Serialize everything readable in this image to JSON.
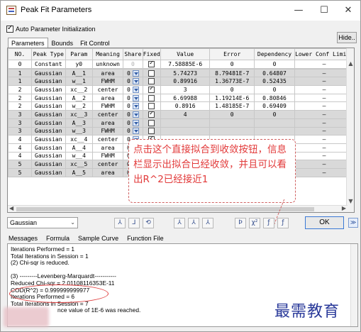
{
  "window": {
    "title": "Peak Fit Parameters",
    "controls": {
      "minimize": "—",
      "maximize": "☐",
      "close": "✕"
    }
  },
  "auto_init": {
    "label": "Auto Parameter Initialization",
    "checked": true
  },
  "hide_button": "Hide..",
  "tabs": [
    "Parameters",
    "Bounds",
    "Fit Control"
  ],
  "columns": [
    "NO.",
    "Peak Type",
    "Param",
    "Meaning",
    "Share",
    "Fixed",
    "Value",
    "Error",
    "Dependency",
    "Lower Conf Limits"
  ],
  "rows": [
    {
      "no": "0",
      "type": "Constant",
      "param": "y0",
      "meaning": "unknown",
      "share": "0",
      "share_dd": false,
      "fixed": true,
      "value": "7.58885E-6",
      "error": "0",
      "dep": "0",
      "lcl": "—",
      "style": "white"
    },
    {
      "no": "1",
      "type": "Gaussian",
      "param": "xc__1",
      "meaning": "center",
      "share": "0",
      "share_dd": true,
      "fixed": true,
      "value": "2",
      "error": "0",
      "dep": "0",
      "lcl": "—",
      "style": "sel"
    },
    {
      "no": "1",
      "type": "Gaussian",
      "param": "A__1",
      "meaning": "area",
      "share": "0",
      "share_dd": true,
      "fixed": false,
      "value": "5.74273",
      "error": "8.79481E-7",
      "dep": "0.64807",
      "lcl": "—",
      "style": "alt"
    },
    {
      "no": "1",
      "type": "Gaussian",
      "param": "w__1",
      "meaning": "FWHM",
      "share": "0",
      "share_dd": true,
      "fixed": false,
      "value": "0.89916",
      "error": "1.36773E-7",
      "dep": "0.52435",
      "lcl": "—",
      "style": "alt"
    },
    {
      "no": "2",
      "type": "Gaussian",
      "param": "xc__2",
      "meaning": "center",
      "share": "0",
      "share_dd": true,
      "fixed": true,
      "value": "3",
      "error": "0",
      "dep": "0",
      "lcl": "—",
      "style": "white"
    },
    {
      "no": "2",
      "type": "Gaussian",
      "param": "A__2",
      "meaning": "area",
      "share": "0",
      "share_dd": true,
      "fixed": false,
      "value": "6.69988",
      "error": "1.19214E-6",
      "dep": "0.80846",
      "lcl": "—",
      "style": "white"
    },
    {
      "no": "2",
      "type": "Gaussian",
      "param": "w__2",
      "meaning": "FWHM",
      "share": "0",
      "share_dd": true,
      "fixed": false,
      "value": "0.8916",
      "error": "1.48185E-7",
      "dep": "0.69409",
      "lcl": "—",
      "style": "white"
    },
    {
      "no": "3",
      "type": "Gaussian",
      "param": "xc__3",
      "meaning": "center",
      "share": "0",
      "share_dd": true,
      "fixed": true,
      "value": "4",
      "error": "0",
      "dep": "0",
      "lcl": "—",
      "style": "alt"
    },
    {
      "no": "3",
      "type": "Gaussian",
      "param": "A__3",
      "meaning": "area",
      "share": "0",
      "share_dd": true,
      "fixed": false,
      "value": "",
      "error": "",
      "dep": "",
      "lcl": "—",
      "style": "alt"
    },
    {
      "no": "3",
      "type": "Gaussian",
      "param": "w__3",
      "meaning": "FWHM",
      "share": "0",
      "share_dd": true,
      "fixed": false,
      "value": "",
      "error": "",
      "dep": "",
      "lcl": "—",
      "style": "alt"
    },
    {
      "no": "4",
      "type": "Gaussian",
      "param": "xc__4",
      "meaning": "center",
      "share": "0",
      "share_dd": true,
      "fixed": true,
      "value": "",
      "error": "",
      "dep": "",
      "lcl": "—",
      "style": "white"
    },
    {
      "no": "4",
      "type": "Gaussian",
      "param": "A__4",
      "meaning": "area",
      "share": "0",
      "share_dd": true,
      "fixed": false,
      "value": "",
      "error": "",
      "dep": "",
      "lcl": "—",
      "style": "white"
    },
    {
      "no": "4",
      "type": "Gaussian",
      "param": "w__4",
      "meaning": "FWHM",
      "share": "0",
      "share_dd": true,
      "fixed": false,
      "value": "",
      "error": "",
      "dep": "",
      "lcl": "—",
      "style": "white"
    },
    {
      "no": "5",
      "type": "Gaussian",
      "param": "xc__5",
      "meaning": "center",
      "share": "0",
      "share_dd": true,
      "fixed": true,
      "value": "",
      "error": "",
      "dep": "",
      "lcl": "—",
      "style": "alt"
    },
    {
      "no": "5",
      "type": "Gaussian",
      "param": "A__5",
      "meaning": "area",
      "share": "0",
      "share_dd": true,
      "fixed": false,
      "value": "",
      "error": "",
      "dep": "",
      "lcl": "—",
      "style": "alt"
    }
  ],
  "annotation": "点击这个直接拟合到收敛按钮，信息栏显示出拟合已经收敛，并且可以看出R^2已经接近1",
  "function_select": "Gaussian",
  "toolbar_icons": [
    "peak-find-icon",
    "fit-one-iter-icon",
    "fit-until-converge-icon",
    "add-peak-icon",
    "delete-peak-icon",
    "guess-icon",
    "feedback-icon",
    "chi-sqr-icon",
    "param-a-icon",
    "param-b-icon"
  ],
  "toolbar_glyphs": [
    "⅄",
    "⅃",
    "⟲",
    "⅄",
    "⅄",
    "⅄",
    "Ϸ",
    "χ²",
    "ƒ",
    "ƒ"
  ],
  "ok_button": "OK",
  "more_button": "≫",
  "lower_tabs": [
    "Messages",
    "Formula",
    "Sample Curve",
    "Function File"
  ],
  "messages": [
    "Iterations Performed = 1",
    "Total Iterations in Session = 1",
    "(2) Chi-sqr is reduced.",
    "",
    "(3) ---------Levenberg-Marquardt-----------",
    "Reduced Chi-sqr = 2.01108116353E-11",
    "COD(R^2) = 0.999999999977",
    "Iterations Performed = 6",
    "Total Iterations in Session = 7",
    "nce value of 1E-6 was reached."
  ],
  "watermark": "最需教育"
}
